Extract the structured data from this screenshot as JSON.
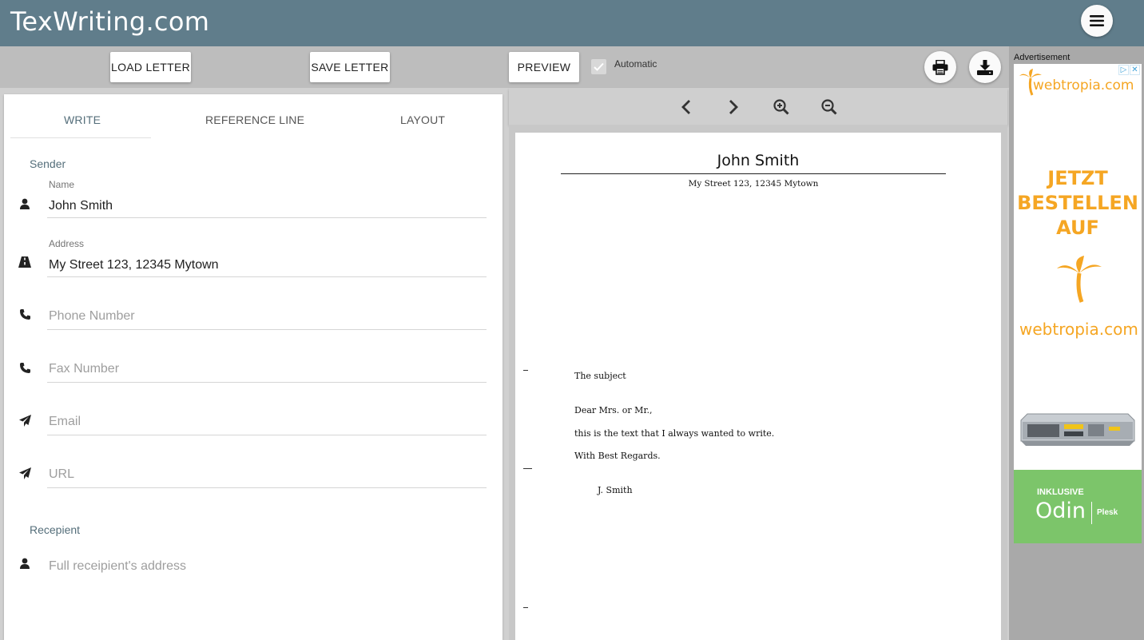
{
  "header": {
    "brand": "TexWriting.com",
    "menu_icon": "hamburger-icon"
  },
  "toolbar": {
    "load_label": "LOAD LETTER",
    "save_label": "SAVE LETTER",
    "preview_label": "PREVIEW",
    "automatic_label": "Automatic",
    "automatic_checked": true
  },
  "tabs": [
    {
      "label": "WRITE",
      "active": true
    },
    {
      "label": "REFERENCE LINE",
      "active": false
    },
    {
      "label": "LAYOUT",
      "active": false
    }
  ],
  "sender": {
    "title": "Sender",
    "name_label": "Name",
    "name_value": "John Smith",
    "address_label": "Address",
    "address_value": "My Street 123, 12345 Mytown",
    "phone_placeholder": "Phone Number",
    "fax_placeholder": "Fax Number",
    "email_placeholder": "Email",
    "url_placeholder": "URL"
  },
  "recipient": {
    "title": "Recepient",
    "address_placeholder": "Full receipient's address"
  },
  "letter": {
    "name": "John Smith",
    "address": "My Street 123, 12345 Mytown",
    "subject": "The subject",
    "opening": "Dear Mrs. or Mr.,",
    "body": "this is the text that I always wanted to write.",
    "closing": "With Best Regards.",
    "signature": "J. Smith"
  },
  "ad": {
    "label": "Advertisement",
    "brand": "webtropia.com",
    "headline_1": "JETZT",
    "headline_2": "BESTELLEN",
    "headline_3": "AUF",
    "bottom_1": "INKLUSIVE",
    "bottom_2": "Odin",
    "bottom_3": "Plesk",
    "accent_color": "#f5a623",
    "green_color": "#7cc56a"
  },
  "colors": {
    "header": "#607d8b",
    "accent": "#546e7a"
  }
}
